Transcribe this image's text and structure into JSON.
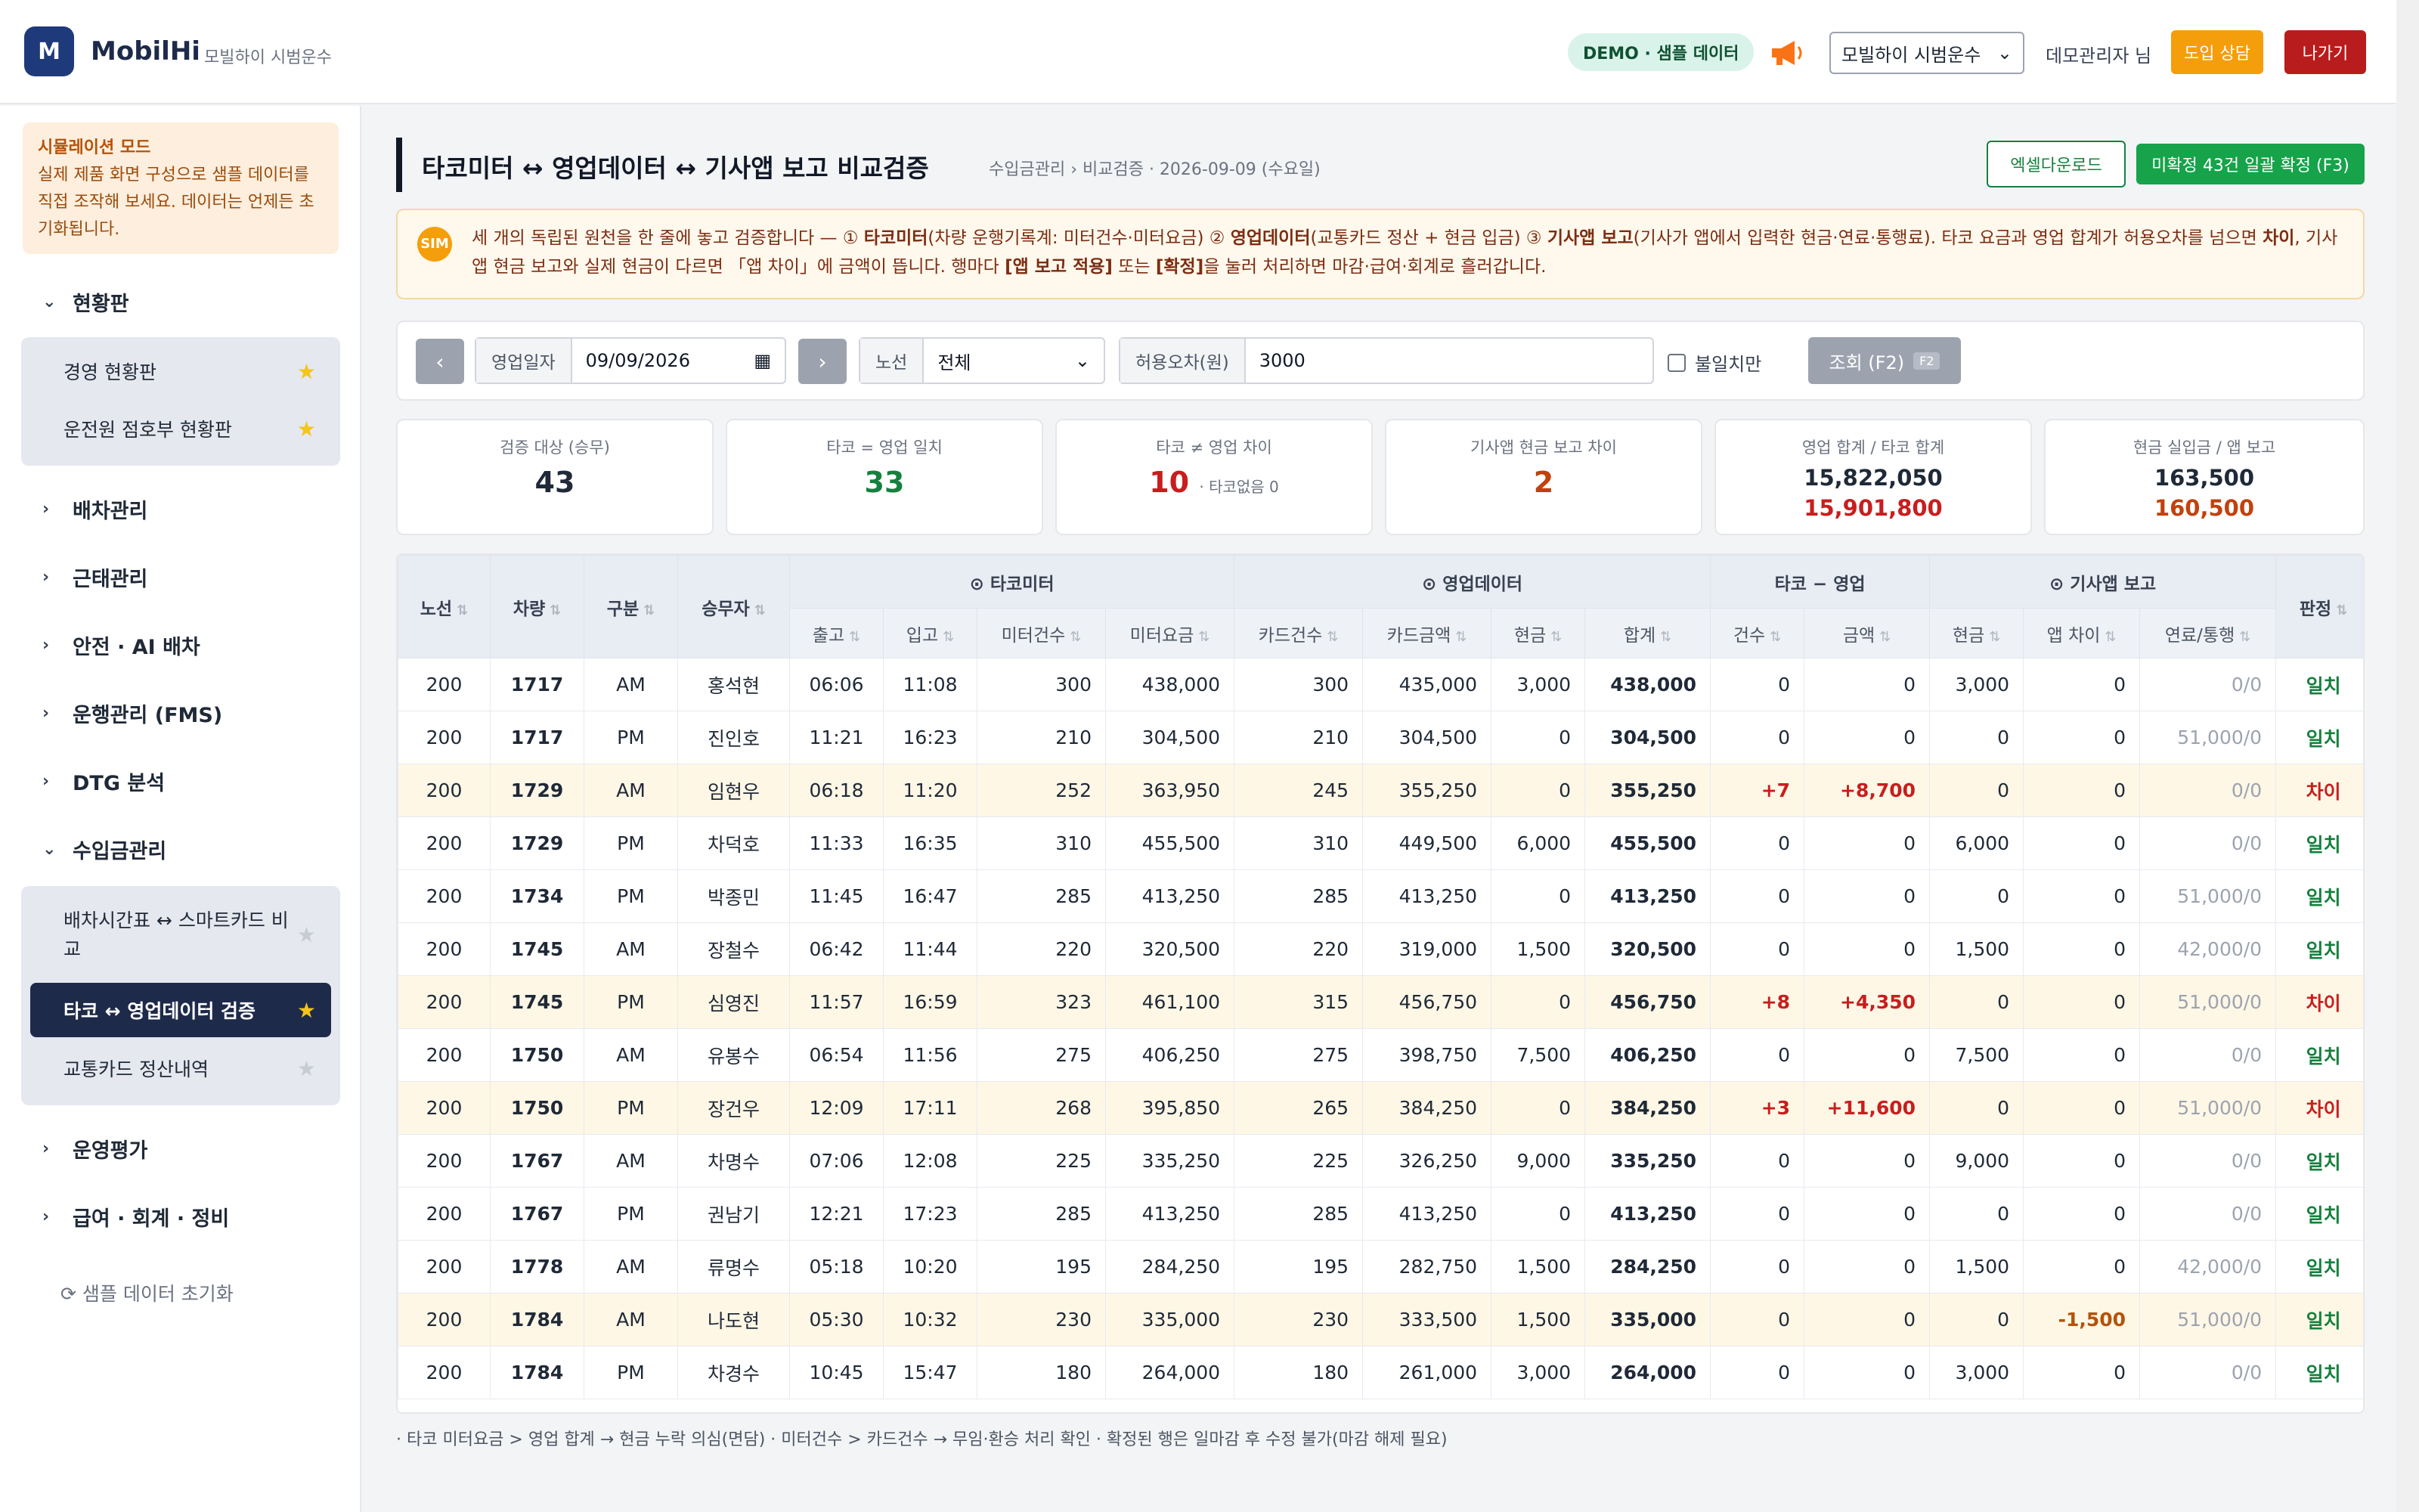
{
  "header": {
    "logo_letter": "M",
    "brand": "MobilHi",
    "brand_sub": "모빌하이 시범운수",
    "demo_badge": "DEMO · 샘플 데이터",
    "company_select": "모빌하이 시범운수",
    "user": "데모관리자 님",
    "consult_btn": "도입 상담",
    "exit_btn": "나가기"
  },
  "sidebar": {
    "sim_title": "시뮬레이션 모드",
    "sim_body": "실제 제품 화면 구성으로 샘플 데이터를 직접 조작해 보세요. 데이터는 언제든 초기화됩니다.",
    "sections": [
      {
        "label": "현황판",
        "expanded": true
      },
      {
        "label": "배차관리",
        "expanded": false
      },
      {
        "label": "근태관리",
        "expanded": false
      },
      {
        "label": "안전 · AI 배차",
        "expanded": false
      },
      {
        "label": "운행관리 (FMS)",
        "expanded": false
      },
      {
        "label": "DTG 분석",
        "expanded": false
      },
      {
        "label": "수입금관리",
        "expanded": true
      },
      {
        "label": "운영평가",
        "expanded": false
      },
      {
        "label": "급여 · 회계 · 정비",
        "expanded": false
      }
    ],
    "dashboard_items": [
      {
        "label": "경영 현황판",
        "starred": true
      },
      {
        "label": "운전원 점호부 현황판",
        "starred": true
      }
    ],
    "revenue_items": [
      {
        "label": "배차시간표 ↔ 스마트카드 비교",
        "starred": false
      },
      {
        "label": "타코 ↔ 영업데이터 검증",
        "starred": true,
        "active": true
      },
      {
        "label": "교통카드 정산내역",
        "starred": false
      }
    ],
    "reset": "샘플 데이터 초기화"
  },
  "page": {
    "title": "타코미터 ↔ 영업데이터 ↔ 기사앱 보고 비교검증",
    "crumb": "수입금관리 › 비교검증 · 2026-09-09 (수요일)",
    "excel_btn": "엑셀다운로드",
    "confirm_btn": "미확정 43건 일괄 확정 (F3)",
    "info_icon": "SIM",
    "info_parts": {
      "p1": "세 개의 독립된 원천을 한 줄에 놓고 검증합니다 — ① ",
      "b1": "타코미터",
      "p2": "(차량 운행기록계: 미터건수·미터요금) ② ",
      "b2": "영업데이터",
      "p3": "(교통카드 정산 + 현금 입금) ③ ",
      "b3": "기사앱 보고",
      "p4": "(기사가 앱에서 입력한 현금·연료·통행료). 타코 요금과 영업 합계가 허용오차를 넘으면 ",
      "b4": "차이",
      "p5": ", 기사앱 현금 보고와 실제 현금이 다르면 「앱 차이」에 금액이 뜹니다. 행마다 ",
      "b5": "[앱 보고 적용]",
      "p6": " 또는 ",
      "b6": "[확정]",
      "p7": "을 눌러 처리하면 마감·급여·회계로 흘러갑니다."
    },
    "footnote": "· 타코 미터요금 > 영업 합계 → 현금 누락 의심(면담) · 미터건수 > 카드건수 → 무임·환승 처리 확인 · 확정된 행은 일마감 후 수정 불가(마감 해제 필요)"
  },
  "filters": {
    "prev": "‹",
    "next": "›",
    "date_label": "영업일자",
    "date_value": "09/09/2026",
    "route_label": "노선",
    "route_value": "전체",
    "tolerance_label": "허용오차(원)",
    "tolerance_value": "3000",
    "mismatch_only": "불일치만",
    "search_btn": "조회 (F2)",
    "search_kbd": "F2"
  },
  "stats": [
    {
      "label": "검증 대상 (승무)",
      "value": "43",
      "color": "#1f2937"
    },
    {
      "label": "타코 = 영업 일치",
      "value": "33",
      "color": "#15803d"
    },
    {
      "label": "타코 ≠ 영업 차이",
      "value": "10",
      "extra": "· 타코없음 0",
      "color": "#c81e1e"
    },
    {
      "label": "기사앱 현금 보고 차이",
      "value": "2",
      "color": "#c2410c"
    },
    {
      "label": "영업 합계 / 타코 합계",
      "v1": "15,822,050",
      "v2": "15,901,800",
      "c1": "#1f2937",
      "c2": "#c81e1e"
    },
    {
      "label": "현금 실입금 / 앱 보고",
      "v1": "163,500",
      "v2": "160,500",
      "c1": "#1f2937",
      "c2": "#c2410c"
    }
  ],
  "table": {
    "group_headers": [
      "⊙ 타코미터",
      "⊙ 영업데이터",
      "타코 − 영업",
      "⊙ 기사앱 보고"
    ],
    "fixed_headers": [
      "노선",
      "차량",
      "구분",
      "승무자"
    ],
    "sub_headers": [
      "출고",
      "입고",
      "미터건수",
      "미터요금",
      "카드건수",
      "카드금액",
      "현금",
      "합계",
      "건수",
      "금액",
      "현금",
      "앱 차이",
      "연료/통행"
    ],
    "verdict_header": "판정",
    "rows": [
      [
        "200",
        "1717",
        "AM",
        "홍석현",
        "06:06",
        "11:08",
        "300",
        "438,000",
        "300",
        "435,000",
        "3,000",
        "438,000",
        "0",
        "0",
        "3,000",
        "0",
        "0/0",
        "일치"
      ],
      [
        "200",
        "1717",
        "PM",
        "진인호",
        "11:21",
        "16:23",
        "210",
        "304,500",
        "210",
        "304,500",
        "0",
        "304,500",
        "0",
        "0",
        "0",
        "0",
        "51,000/0",
        "일치"
      ],
      [
        "200",
        "1729",
        "AM",
        "임현우",
        "06:18",
        "11:20",
        "252",
        "363,950",
        "245",
        "355,250",
        "0",
        "355,250",
        "+7",
        "+8,700",
        "0",
        "0",
        "0/0",
        "차이"
      ],
      [
        "200",
        "1729",
        "PM",
        "차덕호",
        "11:33",
        "16:35",
        "310",
        "455,500",
        "310",
        "449,500",
        "6,000",
        "455,500",
        "0",
        "0",
        "6,000",
        "0",
        "0/0",
        "일치"
      ],
      [
        "200",
        "1734",
        "PM",
        "박종민",
        "11:45",
        "16:47",
        "285",
        "413,250",
        "285",
        "413,250",
        "0",
        "413,250",
        "0",
        "0",
        "0",
        "0",
        "51,000/0",
        "일치"
      ],
      [
        "200",
        "1745",
        "AM",
        "장철수",
        "06:42",
        "11:44",
        "220",
        "320,500",
        "220",
        "319,000",
        "1,500",
        "320,500",
        "0",
        "0",
        "1,500",
        "0",
        "42,000/0",
        "일치"
      ],
      [
        "200",
        "1745",
        "PM",
        "심영진",
        "11:57",
        "16:59",
        "323",
        "461,100",
        "315",
        "456,750",
        "0",
        "456,750",
        "+8",
        "+4,350",
        "0",
        "0",
        "51,000/0",
        "차이"
      ],
      [
        "200",
        "1750",
        "AM",
        "유봉수",
        "06:54",
        "11:56",
        "275",
        "406,250",
        "275",
        "398,750",
        "7,500",
        "406,250",
        "0",
        "0",
        "7,500",
        "0",
        "0/0",
        "일치"
      ],
      [
        "200",
        "1750",
        "PM",
        "장건우",
        "12:09",
        "17:11",
        "268",
        "395,850",
        "265",
        "384,250",
        "0",
        "384,250",
        "+3",
        "+11,600",
        "0",
        "0",
        "51,000/0",
        "차이"
      ],
      [
        "200",
        "1767",
        "AM",
        "차명수",
        "07:06",
        "12:08",
        "225",
        "335,250",
        "225",
        "326,250",
        "9,000",
        "335,250",
        "0",
        "0",
        "9,000",
        "0",
        "0/0",
        "일치"
      ],
      [
        "200",
        "1767",
        "PM",
        "권남기",
        "12:21",
        "17:23",
        "285",
        "413,250",
        "285",
        "413,250",
        "0",
        "413,250",
        "0",
        "0",
        "0",
        "0",
        "0/0",
        "일치"
      ],
      [
        "200",
        "1778",
        "AM",
        "류명수",
        "05:18",
        "10:20",
        "195",
        "284,250",
        "195",
        "282,750",
        "1,500",
        "284,250",
        "0",
        "0",
        "1,500",
        "0",
        "42,000/0",
        "일치"
      ],
      [
        "200",
        "1784",
        "AM",
        "나도현",
        "05:30",
        "10:32",
        "230",
        "335,000",
        "230",
        "333,500",
        "1,500",
        "335,000",
        "0",
        "0",
        "0",
        "-1,500",
        "51,000/0",
        "일치"
      ],
      [
        "200",
        "1784",
        "PM",
        "차경수",
        "10:45",
        "15:47",
        "180",
        "264,000",
        "180",
        "261,000",
        "3,000",
        "264,000",
        "0",
        "0",
        "3,000",
        "0",
        "0/0",
        "일치"
      ]
    ]
  }
}
